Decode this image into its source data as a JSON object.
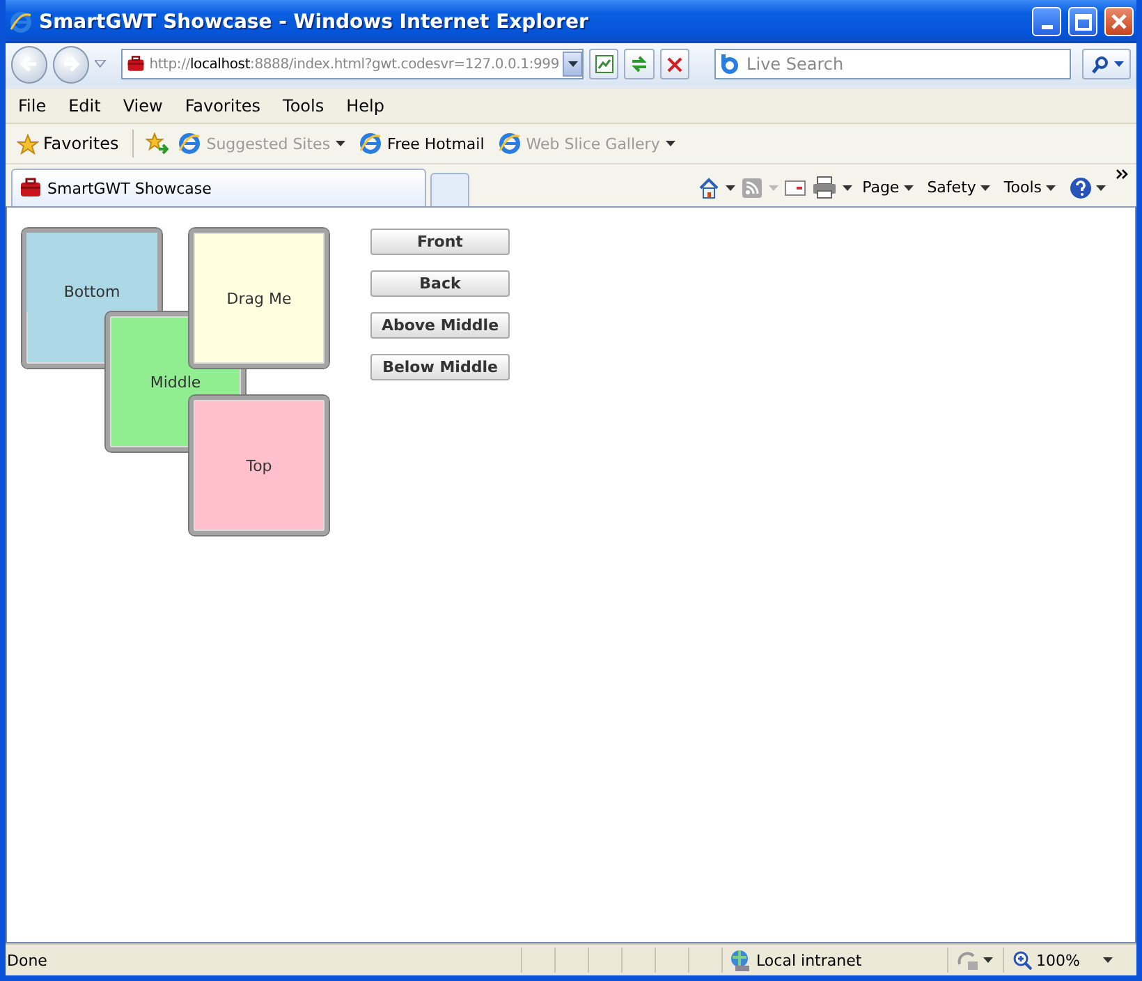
{
  "window": {
    "title": "SmartGWT Showcase - Windows Internet Explorer"
  },
  "address": {
    "scheme": "http://",
    "host": "localhost",
    "rest": ":8888/index.html?gwt.codesvr=127.0.0.1:999"
  },
  "search": {
    "placeholder": "Live Search"
  },
  "menu": [
    "File",
    "Edit",
    "View",
    "Favorites",
    "Tools",
    "Help"
  ],
  "favorites_bar": {
    "label": "Favorites",
    "items": [
      {
        "label": "Suggested Sites",
        "disabled": true,
        "dropdown": true
      },
      {
        "label": "Free Hotmail",
        "disabled": false,
        "dropdown": false
      },
      {
        "label": "Web Slice Gallery",
        "disabled": true,
        "dropdown": true
      }
    ]
  },
  "tabs": [
    {
      "label": "SmartGWT Showcase",
      "selected": true
    }
  ],
  "command_bar": [
    "Page",
    "Safety",
    "Tools"
  ],
  "squares": [
    {
      "label": "Bottom",
      "color": "#add8e6"
    },
    {
      "label": "Middle",
      "color": "#90ee90"
    },
    {
      "label": "Drag Me",
      "color": "#ffffe0"
    },
    {
      "label": "Top",
      "color": "#ffc0cb"
    }
  ],
  "buttons": [
    "Front",
    "Back",
    "Above Middle",
    "Below Middle"
  ],
  "status_bar": {
    "text": "Done",
    "zone": "Local intranet",
    "zoom": "100%"
  }
}
